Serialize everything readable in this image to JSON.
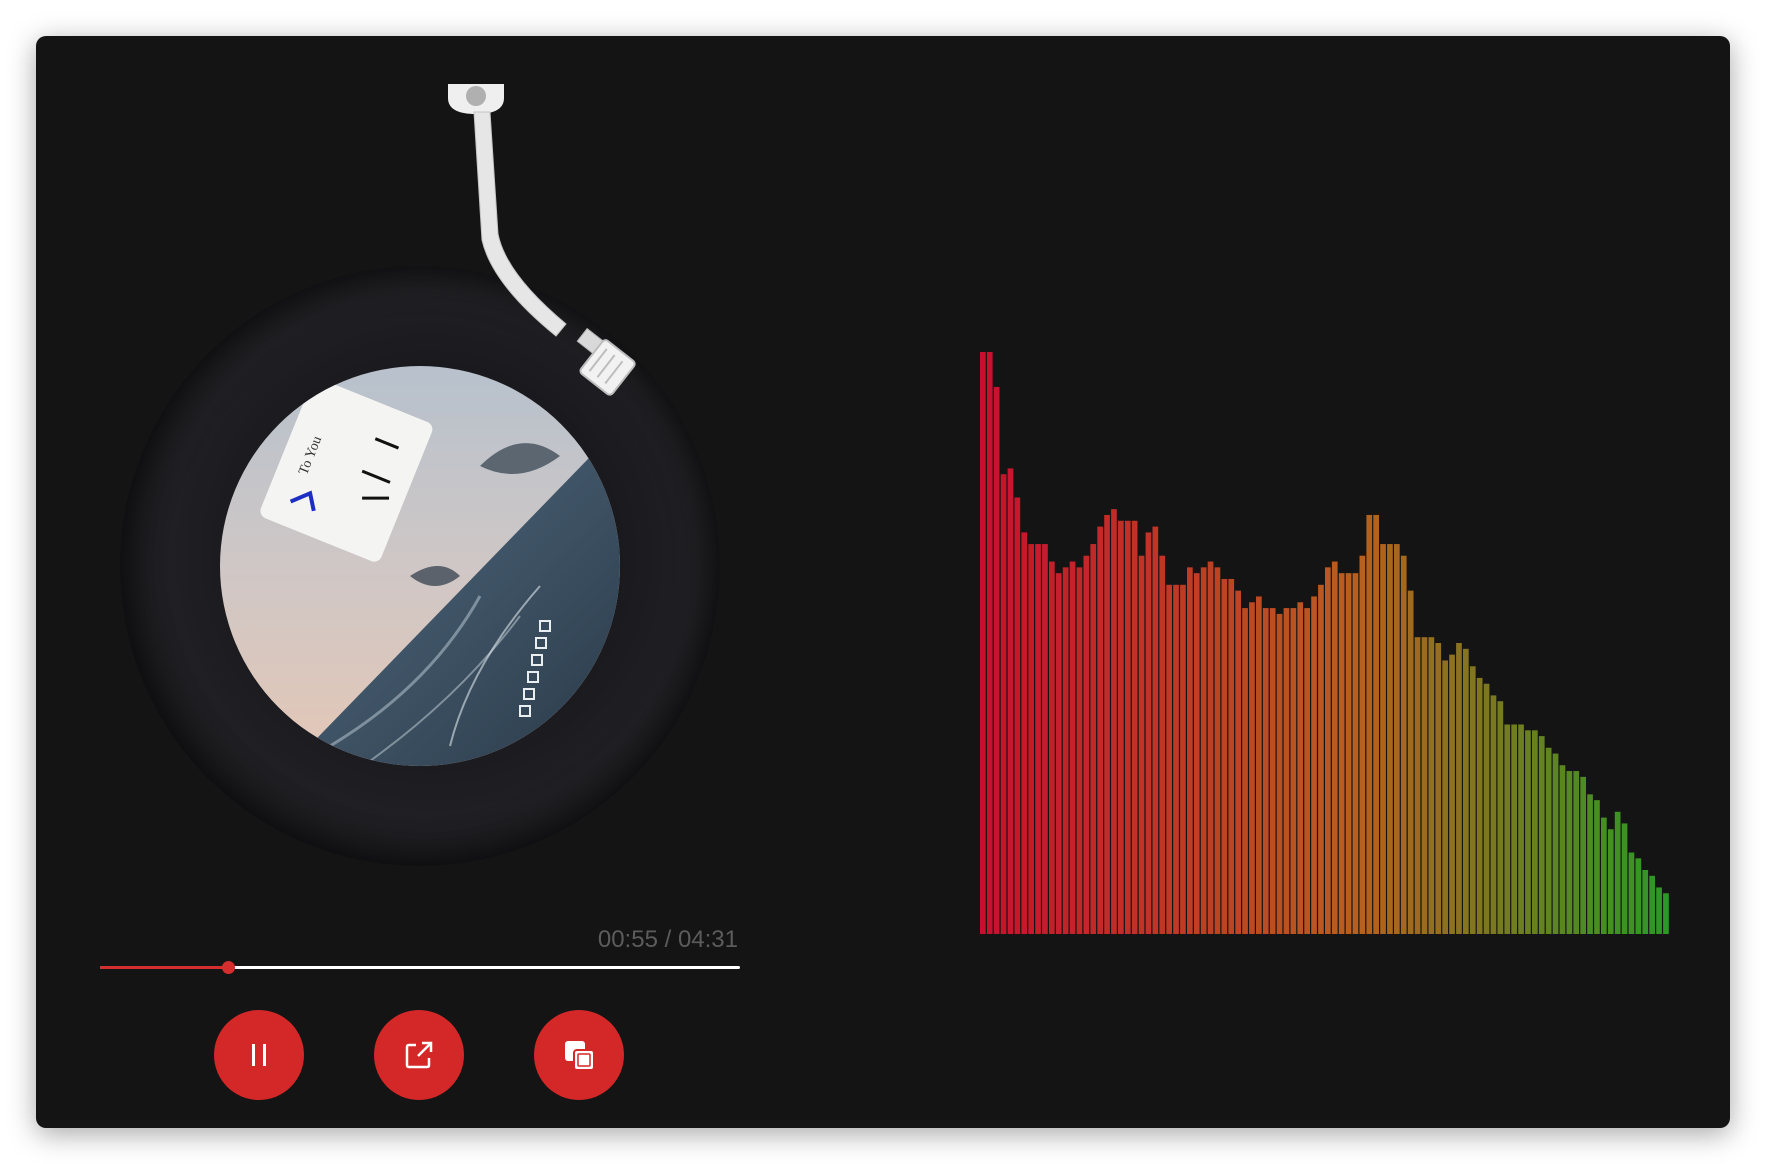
{
  "player": {
    "time_current": "00:55",
    "time_total": "04:31",
    "time_display": "00:55 / 04:31",
    "progress_fraction": 0.2,
    "accent_color": "#d42727",
    "background_color": "#141414"
  },
  "album_cover": {
    "label_text": "To You",
    "icons": [
      "pause-icon",
      "open-external-icon",
      "picture-in-picture-icon"
    ]
  },
  "controls": [
    {
      "name": "pause-button",
      "icon": "pause-icon"
    },
    {
      "name": "open-external-button",
      "icon": "open-external-icon"
    },
    {
      "name": "picture-in-picture-button",
      "icon": "picture-in-picture-icon"
    }
  ],
  "visualizer": {
    "color_low": "#c8102e",
    "color_mid": "#b8601e",
    "color_high": "#2a9a24",
    "levels": [
      1.0,
      1.0,
      0.94,
      0.79,
      0.8,
      0.75,
      0.69,
      0.67,
      0.67,
      0.67,
      0.64,
      0.62,
      0.63,
      0.64,
      0.63,
      0.65,
      0.67,
      0.7,
      0.72,
      0.73,
      0.71,
      0.71,
      0.71,
      0.65,
      0.69,
      0.7,
      0.65,
      0.6,
      0.6,
      0.6,
      0.63,
      0.62,
      0.63,
      0.64,
      0.63,
      0.61,
      0.61,
      0.59,
      0.56,
      0.57,
      0.58,
      0.56,
      0.56,
      0.55,
      0.56,
      0.56,
      0.57,
      0.56,
      0.58,
      0.6,
      0.63,
      0.64,
      0.62,
      0.62,
      0.62,
      0.65,
      0.72,
      0.72,
      0.67,
      0.67,
      0.67,
      0.65,
      0.59,
      0.51,
      0.51,
      0.51,
      0.5,
      0.47,
      0.48,
      0.5,
      0.49,
      0.46,
      0.44,
      0.43,
      0.41,
      0.4,
      0.36,
      0.36,
      0.36,
      0.35,
      0.35,
      0.34,
      0.32,
      0.31,
      0.29,
      0.28,
      0.28,
      0.27,
      0.24,
      0.23,
      0.2,
      0.18,
      0.21,
      0.19,
      0.14,
      0.13,
      0.11,
      0.1,
      0.08,
      0.07
    ]
  }
}
